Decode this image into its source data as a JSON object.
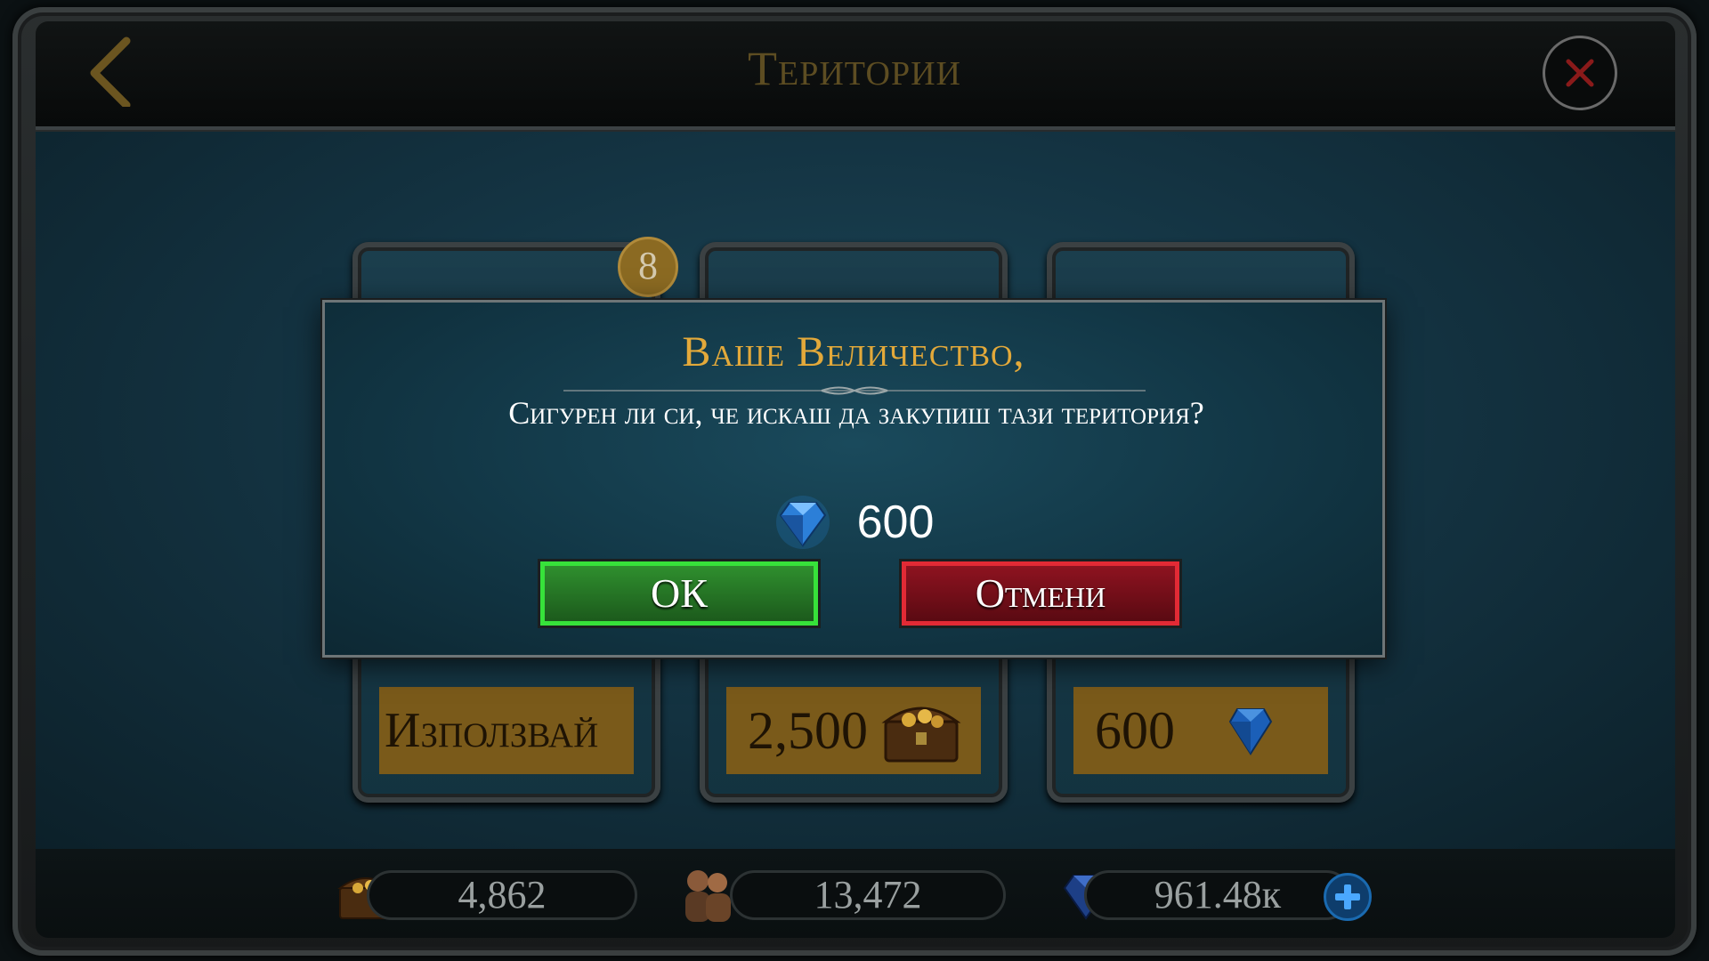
{
  "header": {
    "title": "Територии"
  },
  "cards": [
    {
      "badge": "8",
      "price_label": "Използвай"
    },
    {
      "price_label": "2,500"
    },
    {
      "price_label": "600"
    }
  ],
  "dialog": {
    "title": "Ваше Величество,",
    "message": "Сигурен ли си, че искаш да закупиш тази територия?",
    "cost": "600",
    "ok_label": "ОК",
    "cancel_label": "Отмени"
  },
  "resources": {
    "gold": "4,862",
    "population": "13,472",
    "gems": "961.48к"
  },
  "icons": {
    "back": "back-arrow-icon",
    "close": "close-icon",
    "gem": "gem-icon",
    "gold": "treasure-chest-icon",
    "population": "people-icon",
    "plus": "plus-icon"
  },
  "colors": {
    "title_gold": "#e3a93a",
    "ok_green": "#37e23a",
    "cancel_red": "#e22a35"
  }
}
